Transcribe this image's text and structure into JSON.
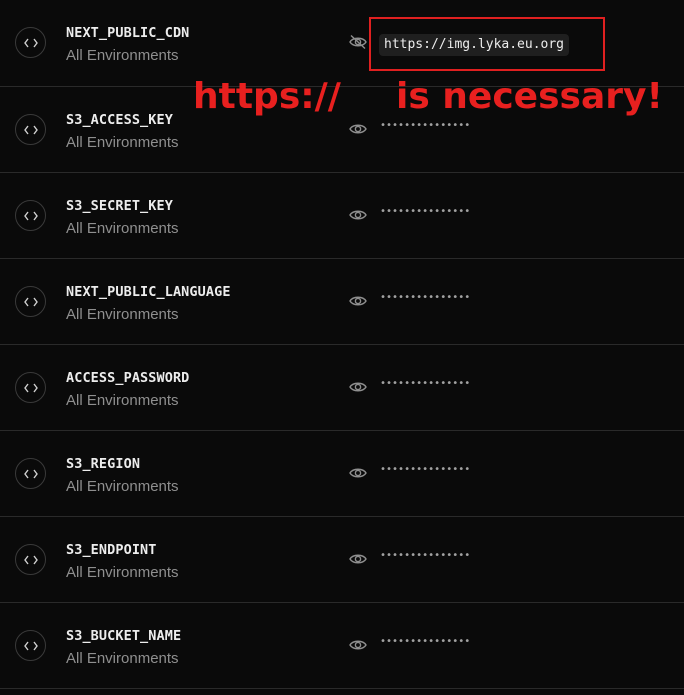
{
  "rows": [
    {
      "key": "NEXT_PUBLIC_CDN",
      "scope": "All Environments",
      "revealed": true,
      "value": "https://img.lyka.eu.org"
    },
    {
      "key": "S3_ACCESS_KEY",
      "scope": "All Environments",
      "revealed": false,
      "value": "•••••••••••••••"
    },
    {
      "key": "S3_SECRET_KEY",
      "scope": "All Environments",
      "revealed": false,
      "value": "•••••••••••••••"
    },
    {
      "key": "NEXT_PUBLIC_LANGUAGE",
      "scope": "All Environments",
      "revealed": false,
      "value": "•••••••••••••••"
    },
    {
      "key": "ACCESS_PASSWORD",
      "scope": "All Environments",
      "revealed": false,
      "value": "•••••••••••••••"
    },
    {
      "key": "S3_REGION",
      "scope": "All Environments",
      "revealed": false,
      "value": "•••••••••••••••"
    },
    {
      "key": "S3_ENDPOINT",
      "scope": "All Environments",
      "revealed": false,
      "value": "•••••••••••••••"
    },
    {
      "key": "S3_BUCKET_NAME",
      "scope": "All Environments",
      "revealed": false,
      "value": "•••••••••••••••"
    }
  ],
  "annotation": {
    "part1": "https://",
    "part2": "is  necessary!",
    "color": "#e8201f"
  },
  "icons": {
    "row": "code-brackets-icon",
    "hidden": "eye-icon",
    "revealed": "eye-off-icon"
  }
}
